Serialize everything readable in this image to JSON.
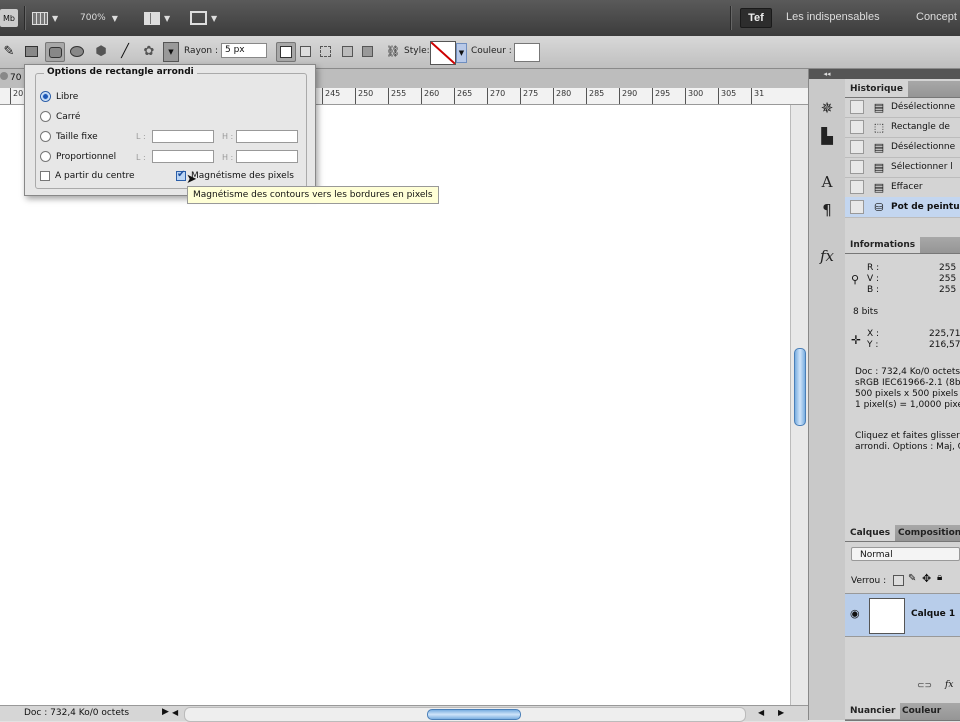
{
  "app_bar": {
    "mb_label": "Mb",
    "zoom": "700%",
    "workspace_active": "Tef",
    "workspace_essentials": "Les indispensables",
    "workspace_design": "Concept"
  },
  "options_bar": {
    "radius_label": "Rayon :",
    "radius_value": "5 px",
    "style_label": "Style:",
    "color_label": "Couleur :"
  },
  "document": {
    "tab_zoom": "70",
    "ruler_ticks": [
      "245",
      "250",
      "255",
      "260",
      "265",
      "270",
      "275",
      "280",
      "285",
      "290",
      "295",
      "300",
      "305",
      "31"
    ]
  },
  "popup": {
    "title": "Options de rectangle arrondi",
    "option_free": "Libre",
    "option_square": "Carré",
    "option_fixed": "Taille fixe",
    "option_proportional": "Proportionnel",
    "option_from_center": "A partir du centre",
    "option_snap": "Magnétisme des pixels",
    "w_label": "L :",
    "h_label": "H :",
    "tooltip": "Magnétisme des contours vers les bordures en pixels"
  },
  "status_bar": {
    "doc_size": "Doc : 732,4 Ko/0 octets"
  },
  "history_panel": {
    "tab": "Historique",
    "items": [
      {
        "label": "Désélectionne",
        "icon": "doc-icon"
      },
      {
        "label": "Rectangle de",
        "icon": "marquee-icon"
      },
      {
        "label": "Désélectionne",
        "icon": "doc-icon"
      },
      {
        "label": "Sélectionner l",
        "icon": "doc-icon"
      },
      {
        "label": "Effacer",
        "icon": "doc-icon"
      },
      {
        "label": "Pot de peintu",
        "icon": "bucket-icon"
      }
    ]
  },
  "info_panel": {
    "tab": "Informations",
    "r_label": "R :",
    "r_value": "255",
    "v_label": "V :",
    "v_value": "255",
    "b_label": "B :",
    "b_value": "255",
    "bits": "8 bits",
    "x_label": "X :",
    "x_value": "225,71",
    "y_label": "Y :",
    "y_value": "216,57",
    "doc_line": "Doc : 732,4 Ko/0 octets",
    "profile_line": "sRGB IEC61966-2.1 (8bp",
    "pixels_line": "500 pixels x 500 pixels",
    "ratio_line": "1 pixel(s) = 1,0000 pixe",
    "hint_line1": "Cliquez et faites glisser",
    "hint_line2": "arrondi. Options : Maj, O"
  },
  "layers_panel": {
    "tab_layers": "Calques",
    "tab_comps": "Compositions",
    "blend_mode": "Normal",
    "lock_label": "Verrou :",
    "layer_name": "Calque 1"
  },
  "bottom_tabs": {
    "swatches": "Nuancier",
    "color": "Couleur"
  }
}
